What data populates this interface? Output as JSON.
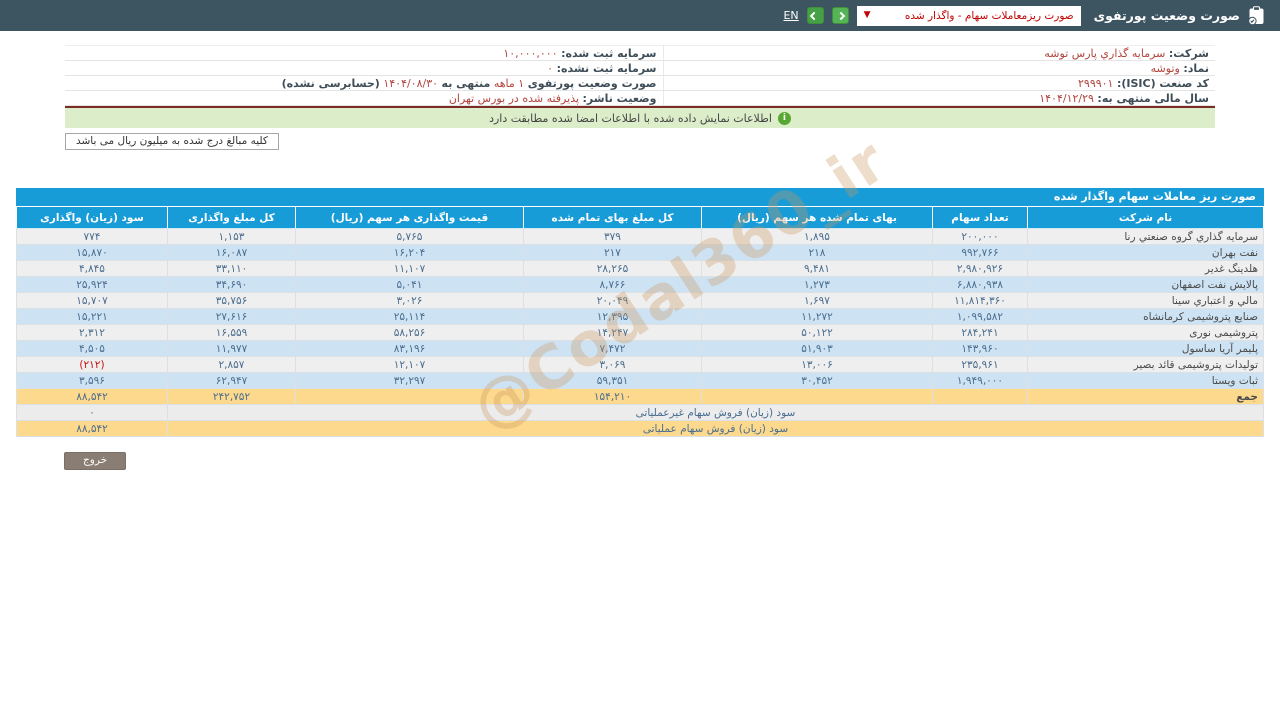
{
  "topbar": {
    "lang_link": "EN",
    "app_title": "صورت وضعیت پورتفوی",
    "report_dropdown_value": "صورت ریزمعاملات سهام - واگذار شده"
  },
  "company_info": {
    "rows": [
      {
        "r_label": "شرکت:",
        "r_value": "سرمایه گذاري پارس توشه",
        "l_label": "سرمایه ثبت شده:",
        "l_value": "۱۰,۰۰۰,۰۰۰"
      },
      {
        "r_label": "نماد:",
        "r_value": "وتوشه",
        "l_label": "سرمایه ثبت نشده:",
        "l_value": "۰"
      },
      {
        "r_label": "کد صنعت (ISIC):",
        "r_value": "۲۹۹۹۰۱"
      },
      {
        "r_label": "سال مالی منتهی به:",
        "r_value": "۱۴۰۴/۱۲/۲۹",
        "l_label": "وضعیت ناشر:",
        "l_value": "پذیرفته شده در بورس تهران"
      }
    ],
    "period_statement": {
      "prefix": "صورت وضعیت پورتفوی",
      "period": "۱ ماهه",
      "middle": "منتهی به",
      "date": "۱۴۰۴/۰۸/۳۰",
      "suffix": "(حسابرسی نشده)"
    }
  },
  "alert": {
    "text": "اطلاعات نمایش داده شده با اطلاعات امضا شده مطابقت دارد"
  },
  "note": {
    "text": "کلیه مبالغ درج شده به میلیون ریال می باشد"
  },
  "table": {
    "title": "صورت ریز معاملات سهام واگذار شده",
    "columns": [
      "نام شرکت",
      "تعداد سهام",
      "بهای تمام شده هر سهم (ریال)",
      "کل مبلغ بهای تمام شده",
      "قیمت واگذاری هر سهم (ریال)",
      "کل مبلغ واگذاری",
      "سود (زیان) واگذاری"
    ],
    "rows": [
      [
        "سرمایه گذاري گروه صنعتي رنا",
        "۲۰۰,۰۰۰",
        "۱,۸۹۵",
        "۳۷۹",
        "۵,۷۶۵",
        "۱,۱۵۳",
        "۷۷۴"
      ],
      [
        "نفت بهران",
        "۹۹۲,۷۶۶",
        "۲۱۸",
        "۲۱۷",
        "۱۶,۲۰۴",
        "۱۶,۰۸۷",
        "۱۵,۸۷۰"
      ],
      [
        "هلدینگ غدیر",
        "۲,۹۸۰,۹۲۶",
        "۹,۴۸۱",
        "۲۸,۲۶۵",
        "۱۱,۱۰۷",
        "۳۳,۱۱۰",
        "۴,۸۴۵"
      ],
      [
        "پالایش نفت اصفهان",
        "۶,۸۸۰,۹۳۸",
        "۱,۲۷۳",
        "۸,۷۶۶",
        "۵,۰۴۱",
        "۳۴,۶۹۰",
        "۲۵,۹۲۴"
      ],
      [
        "مالي و اعتباري سينا",
        "۱۱,۸۱۴,۳۶۰",
        "۱,۶۹۷",
        "۲۰,۰۴۹",
        "۳,۰۲۶",
        "۳۵,۷۵۶",
        "۱۵,۷۰۷"
      ],
      [
        "صنایع پتروشیمی کرمانشاه",
        "۱,۰۹۹,۵۸۲",
        "۱۱,۲۷۲",
        "۱۲,۳۹۵",
        "۲۵,۱۱۴",
        "۲۷,۶۱۶",
        "۱۵,۲۲۱"
      ],
      [
        "پتروشیمی نوری",
        "۲۸۴,۲۴۱",
        "۵۰,۱۲۲",
        "۱۴,۲۴۷",
        "۵۸,۲۵۶",
        "۱۶,۵۵۹",
        "۲,۳۱۲"
      ],
      [
        "پلیمر آریا ساسول",
        "۱۴۳,۹۶۰",
        "۵۱,۹۰۳",
        "۷,۴۷۲",
        "۸۳,۱۹۶",
        "۱۱,۹۷۷",
        "۴,۵۰۵"
      ],
      [
        "تولیدات پتروشیمی قائد بصیر",
        "۲۳۵,۹۶۱",
        "۱۳,۰۰۶",
        "۳,۰۶۹",
        "۱۲,۱۰۷",
        "۲,۸۵۷",
        "(۲۱۲)"
      ],
      [
        "ثبات ویستا",
        "۱,۹۴۹,۰۰۰",
        "۳۰,۴۵۲",
        "۵۹,۳۵۱",
        "۳۲,۲۹۷",
        "۶۲,۹۴۷",
        "۳,۵۹۶"
      ]
    ],
    "total": {
      "label": "جمع",
      "cost_total": "۱۵۴,۲۱۰",
      "transfer_total": "۲۴۲,۷۵۲",
      "gain": "۸۸,۵۴۲"
    },
    "footer_rows": [
      {
        "label": "سود (زیان) فروش سهام غیرعملیاتی",
        "value": "۰"
      },
      {
        "label": "سود (زیان) فروش سهام عملیاتی",
        "value": "۸۸,۵۴۲"
      }
    ]
  },
  "exit_button": "خروج",
  "watermark": "@Codal360_ir",
  "colors": {
    "topbar_bg": "#3d5561",
    "table_header_blue": "#189cd8",
    "alt_row_blue": "#cde3f4",
    "highlight_yellow": "#fcd98c",
    "value_red": "#b2453e",
    "alert_green_bg": "#dcedca"
  }
}
